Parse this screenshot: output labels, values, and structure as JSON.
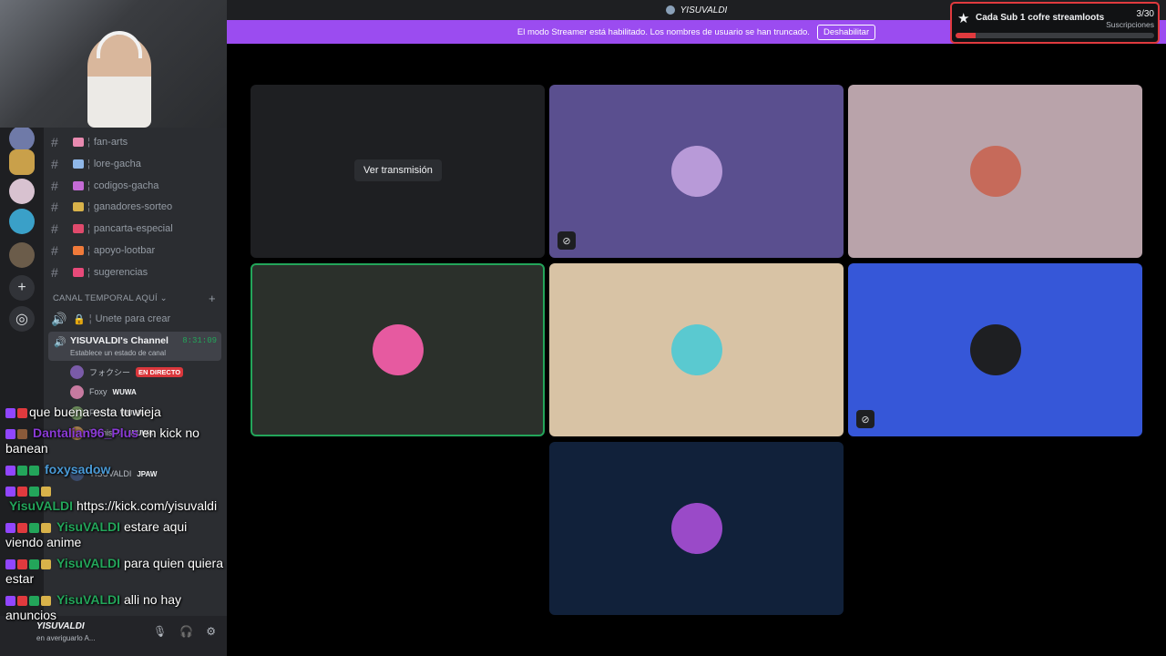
{
  "topbar": {
    "title": "YISUVALDI"
  },
  "banner": {
    "text": "El modo Streamer está habilitado. Los nombres de usuario se han truncado.",
    "button": "Deshabilitar"
  },
  "streamloots": {
    "label": "Cada Sub 1 cofre streamloots",
    "count": "3/30",
    "sub": "Suscripciones",
    "progress": 0.1
  },
  "channels": [
    {
      "name": "fan-arts",
      "emoji_color": "#e88ab0"
    },
    {
      "name": "lore-gacha",
      "emoji_color": "#8fb7e8"
    },
    {
      "name": "codigos-gacha",
      "emoji_color": "#c46bd6"
    },
    {
      "name": "ganadores-sorteo",
      "emoji_color": "#d8b24a"
    },
    {
      "name": "pancarta-especial",
      "emoji_color": "#e04a6c"
    },
    {
      "name": "apoyo-lootbar",
      "emoji_color": "#f07a3a"
    },
    {
      "name": "sugerencias",
      "emoji_color": "#e84a7a"
    }
  ],
  "category": "CANAL TEMPORAL AQUÍ",
  "voice_create": "Unete para crear",
  "voice_channel": {
    "name": "YISUVALDI's Channel",
    "status": "Establece un estado de canal",
    "timer": "8:31:09"
  },
  "voice_users": [
    {
      "name": "フォクシー",
      "tag": "",
      "live": "EN DIRECTO",
      "color": "#7a5ba8"
    },
    {
      "name": "Foxy",
      "tag": "WUWA",
      "live": "",
      "color": "#c77aa0"
    },
    {
      "name": "Fransb",
      "tag": "WUWA",
      "live": "",
      "color": "#6a8a5a"
    },
    {
      "name": "TechisDX",
      "tag": "WUWA",
      "live": "",
      "color": "#a07a4a"
    },
    {
      "name": "YISUVALDI",
      "tag": "JPAW",
      "live": "",
      "color": "#3a4a6a"
    }
  ],
  "chat": [
    {
      "badge_colors": [
        "#9146ff",
        "#e03a3e"
      ],
      "user": "",
      "user_color": "#e03a3e",
      "text": "que buena esta tu vieja"
    },
    {
      "badge_colors": [
        "#9146ff",
        "#8a5a3a"
      ],
      "user": "Dantalian96_Plus",
      "user_color": "#8a3ad6",
      "text": "en kick no banean"
    },
    {
      "badge_colors": [
        "#9146ff",
        "#23a55a",
        "#23a55a"
      ],
      "user": "foxysadow",
      "user_color": "#4a9ad6",
      "text": ""
    },
    {
      "badge_colors": [
        "#9146ff",
        "#e03a3e",
        "#23a55a",
        "#d8b24a"
      ],
      "user": "YisuVALDI",
      "user_color": "#23a55a",
      "text": "https://kick.com/yisuvaldi"
    },
    {
      "badge_colors": [
        "#9146ff",
        "#e03a3e",
        "#23a55a",
        "#d8b24a"
      ],
      "user": "YisuVALDI",
      "user_color": "#23a55a",
      "text": "estare aqui viendo anime"
    },
    {
      "badge_colors": [
        "#9146ff",
        "#e03a3e",
        "#23a55a",
        "#d8b24a"
      ],
      "user": "YisuVALDI",
      "user_color": "#23a55a",
      "text": "para quien quiera estar"
    },
    {
      "badge_colors": [
        "#9146ff",
        "#e03a3e",
        "#23a55a",
        "#d8b24a"
      ],
      "user": "YisuVALDI",
      "user_color": "#23a55a",
      "text": "alli no hay anuncios"
    }
  ],
  "user_panel": {
    "name": "YISUVALDI",
    "status": "en averiguarlo A..."
  },
  "tiles": [
    {
      "bg": "#1e1f22",
      "avatar": "",
      "muted": false,
      "stream_label": "Ver transmisión"
    },
    {
      "bg": "#5a4f8f",
      "avatar": "#b89ad8",
      "muted": true,
      "stream_label": ""
    },
    {
      "bg": "#b9a3aa",
      "avatar": "#c66a5a",
      "muted": false,
      "stream_label": ""
    },
    {
      "bg": "#2b302b",
      "avatar": "#e65aa0",
      "muted": false,
      "stream_label": ""
    },
    {
      "bg": "#d8c3a5",
      "avatar": "#5ac9d0",
      "muted": false,
      "stream_label": ""
    },
    {
      "bg": "#3657d8",
      "avatar": "#1e1f22",
      "muted": true,
      "stream_label": ""
    },
    {
      "bg": "#11213a",
      "avatar": "#9a4ac8",
      "muted": false,
      "stream_label": ""
    }
  ]
}
